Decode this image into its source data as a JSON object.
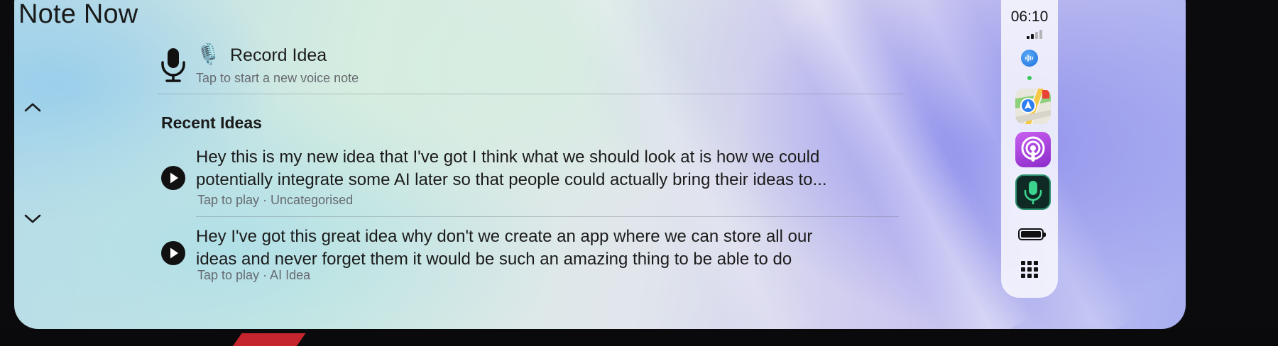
{
  "app": {
    "title": "Note Now"
  },
  "record": {
    "icon": "microphone-icon",
    "emoji": "🎙️",
    "title": "Record Idea",
    "subtitle": "Tap to start a new voice note"
  },
  "recent": {
    "heading": "Recent Ideas",
    "items": [
      {
        "line1": "Hey this is my new idea that I've got I think what we should look at is how we could",
        "line2": "potentially integrate some AI later so that people could actually bring their ideas to...",
        "meta": "Tap to play · Uncategorised"
      },
      {
        "line1": "Hey I've got this great idea why don't we create an app where we can store all our",
        "line2": "ideas and never forget them it would be such an amazing thing to be able to do",
        "meta": "Tap to play · AI Idea"
      }
    ]
  },
  "navigation": {
    "up_icon": "chevron-up-icon",
    "down_icon": "chevron-down-icon"
  },
  "dock": {
    "time": "06:10",
    "signal_bars_active": 2,
    "signal_bars_total": 4,
    "apps": [
      "siri-icon",
      "maps-icon",
      "podcasts-icon",
      "note-now-icon"
    ],
    "status": [
      "battery-icon",
      "app-grid-icon"
    ]
  },
  "colors": {
    "podcasts": "#a43fd6",
    "note_now_bg": "#0f2a24",
    "note_now_mic": "#3bd38e",
    "siri": "#2a7be4",
    "text": "#1b1b1b",
    "secondary_text": "#666a70"
  }
}
